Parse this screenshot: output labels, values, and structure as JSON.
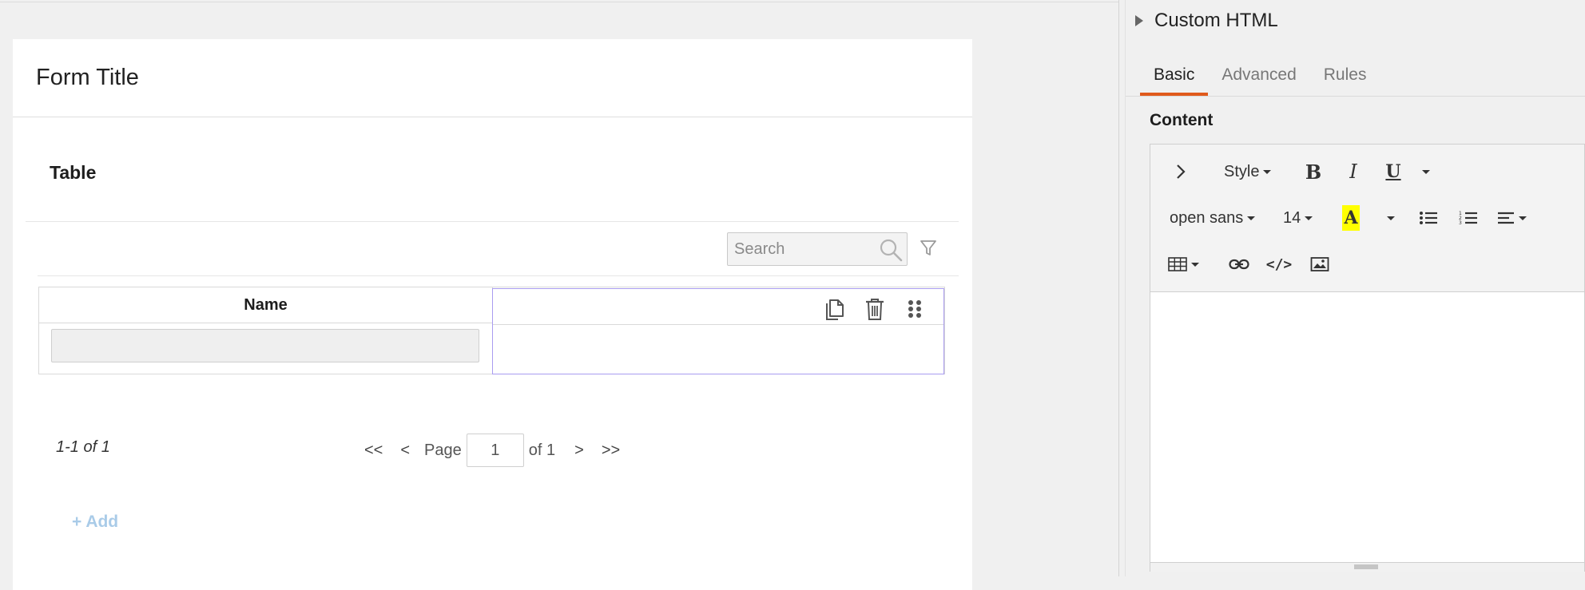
{
  "form": {
    "title": "Form Title",
    "section_title": "Table",
    "search_placeholder": "Search",
    "table": {
      "columns": [
        "Name",
        ""
      ],
      "rows": [
        {
          "name": ""
        }
      ]
    },
    "pager": {
      "count": "1-1 of 1",
      "first": "<<",
      "prev": "<",
      "page_label": "Page",
      "page_value": "1",
      "of_label": "of 1",
      "next": ">",
      "last": ">>"
    },
    "add_label": "+ Add"
  },
  "panel": {
    "title": "Custom HTML",
    "tabs": [
      {
        "label": "Basic",
        "active": true
      },
      {
        "label": "Advanced",
        "active": false
      },
      {
        "label": "Rules",
        "active": false
      }
    ],
    "content_label": "Content",
    "editor": {
      "style_label": "Style",
      "font_family": "open sans",
      "font_size": "14",
      "highlight_color": "#ffff00",
      "code_label": "</>"
    }
  },
  "colors": {
    "tab_active": "#e05a1c",
    "selected_column_border": "#a99cf0",
    "add_link": "#a9cbe8"
  }
}
